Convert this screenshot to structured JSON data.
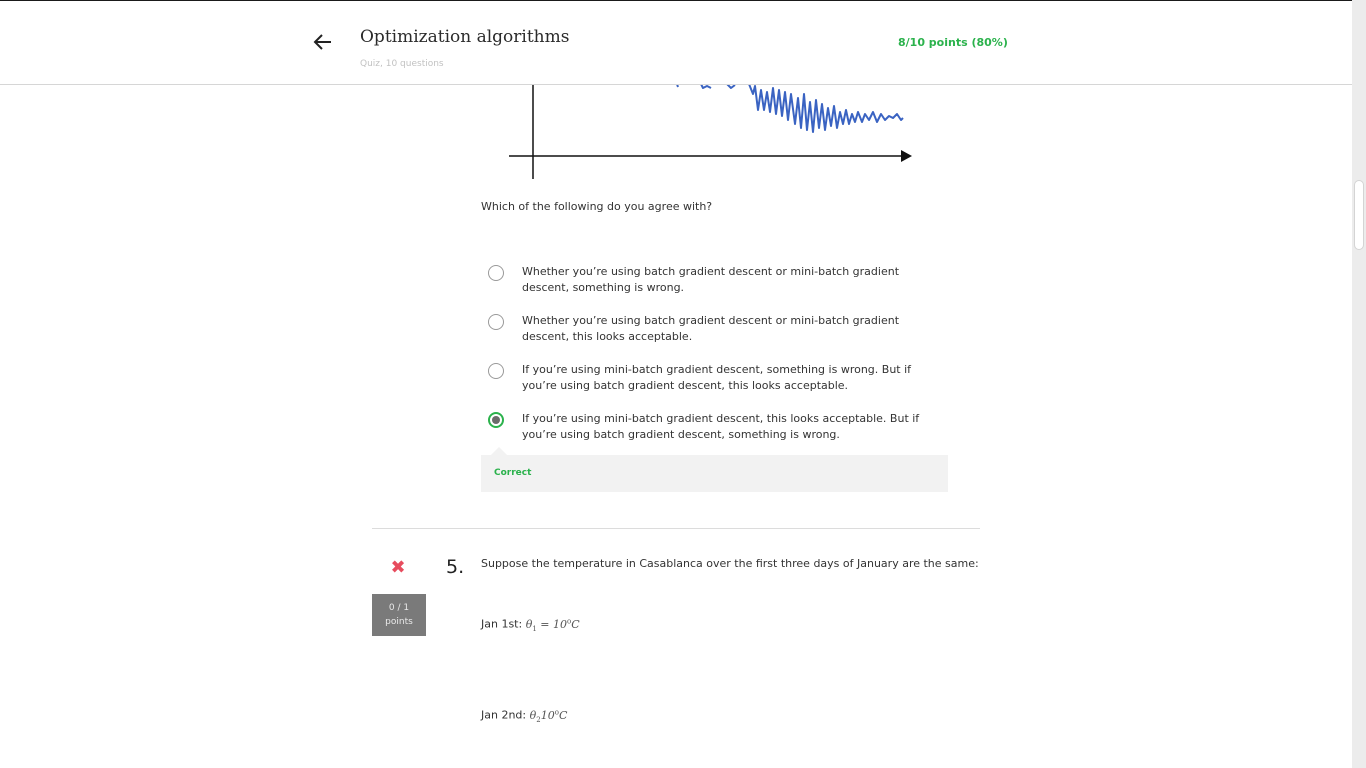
{
  "header": {
    "title": "Optimization algorithms",
    "subtitle": "Quiz, 10 questions",
    "score": "8/10 points (80%)",
    "accent_color": "#2bb24c"
  },
  "question4": {
    "prompt": "Which of the following do you agree with?",
    "options": [
      {
        "label": "Whether you’re using batch gradient descent or mini-batch gradient descent, something is wrong.",
        "selected": false
      },
      {
        "label": "Whether you’re using batch gradient descent or mini-batch gradient descent, this looks acceptable.",
        "selected": false
      },
      {
        "label": "If you’re using mini-batch gradient descent, something is wrong. But if you’re using batch gradient descent, this looks acceptable.",
        "selected": false
      },
      {
        "label": "If you’re using mini-batch gradient descent, this looks acceptable. But if you’re using batch gradient descent, something is wrong.",
        "selected": true
      }
    ],
    "feedback": "Correct"
  },
  "question5": {
    "number": "5.",
    "status_icon": "x-icon",
    "points_line1": "0 / 1",
    "points_line2": "points",
    "prompt": "Suppose the temperature in Casablanca over the first three days of January are the same:",
    "days": [
      {
        "label": "Jan 1st:",
        "theta": "θ",
        "sub": "1",
        "eq": " = 10",
        "deg": "o",
        "unit": "C"
      },
      {
        "label": "Jan 2nd:",
        "theta": "θ",
        "sub": "2",
        "eq": "10",
        "deg": "o",
        "unit": "C"
      }
    ]
  },
  "icons": {
    "back": "arrow-left-icon",
    "wrong": "x-icon",
    "radio": "radio-icon"
  }
}
